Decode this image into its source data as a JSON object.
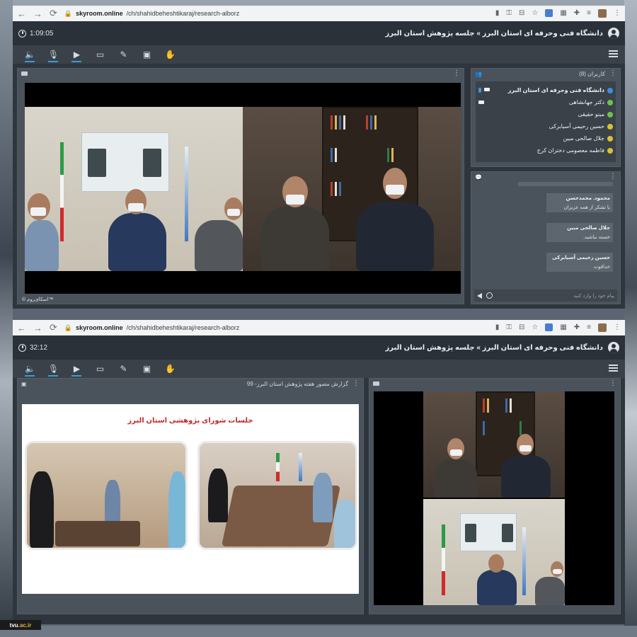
{
  "browser": {
    "url_domain": "skyroom.online",
    "url_path": "/ch/shahidbeheshtikaraj/research-alborz"
  },
  "room": {
    "title": "دانشگاه فنی وحرفه ای استان البرز » جلسه پژوهش استان البرز"
  },
  "session1": {
    "timer": "1:09:05",
    "users_panel": {
      "title": "کاربران (8)",
      "users": [
        {
          "name": "دانشگاه فنی وحرفه ای استان البرز",
          "icon": "user-blue-icon",
          "mic": true,
          "cam": true
        },
        {
          "name": "دکتر جهانشاهی",
          "icon": "user-green-icon",
          "mic": false,
          "cam": true
        },
        {
          "name": "مینو حقیقی",
          "icon": "user-green-icon",
          "mic": false,
          "cam": false
        },
        {
          "name": "حسین رحیمی آسیابرکی",
          "icon": "user-yellow-icon",
          "mic": false,
          "cam": false
        },
        {
          "name": "جلال صالحی مبین",
          "icon": "user-yellow-icon",
          "mic": false,
          "cam": false
        },
        {
          "name": "فاطمه معصومی دختران کرج",
          "icon": "user-yellow-icon",
          "mic": false,
          "cam": false
        }
      ]
    },
    "chat": {
      "messages": [
        {
          "sender": "محمود. محمدحسن",
          "text": "با تشکر از همه عزیزان"
        },
        {
          "sender": "جلال صالحی مبین",
          "text": "خسته نباشید."
        },
        {
          "sender": "حسین رحیمی آسیابرکی",
          "text": "خداقوت"
        }
      ],
      "placeholder": "پیام خود را وارد کنید"
    },
    "video_caption": "© اسکای‌روم™"
  },
  "session2": {
    "timer": "32:12",
    "presentation": {
      "title": "گزارش مصور هفته پژوهش استان البرز- 99",
      "slide_heading": "جلسات شورای پژوهشی استان البرز"
    }
  },
  "watermark": {
    "prefix": "tvu",
    "suffix": ".ac.ir"
  },
  "colors": {
    "accent": "#3a9bd8",
    "panel": "#4a525b",
    "titlebar": "#2b3138"
  }
}
